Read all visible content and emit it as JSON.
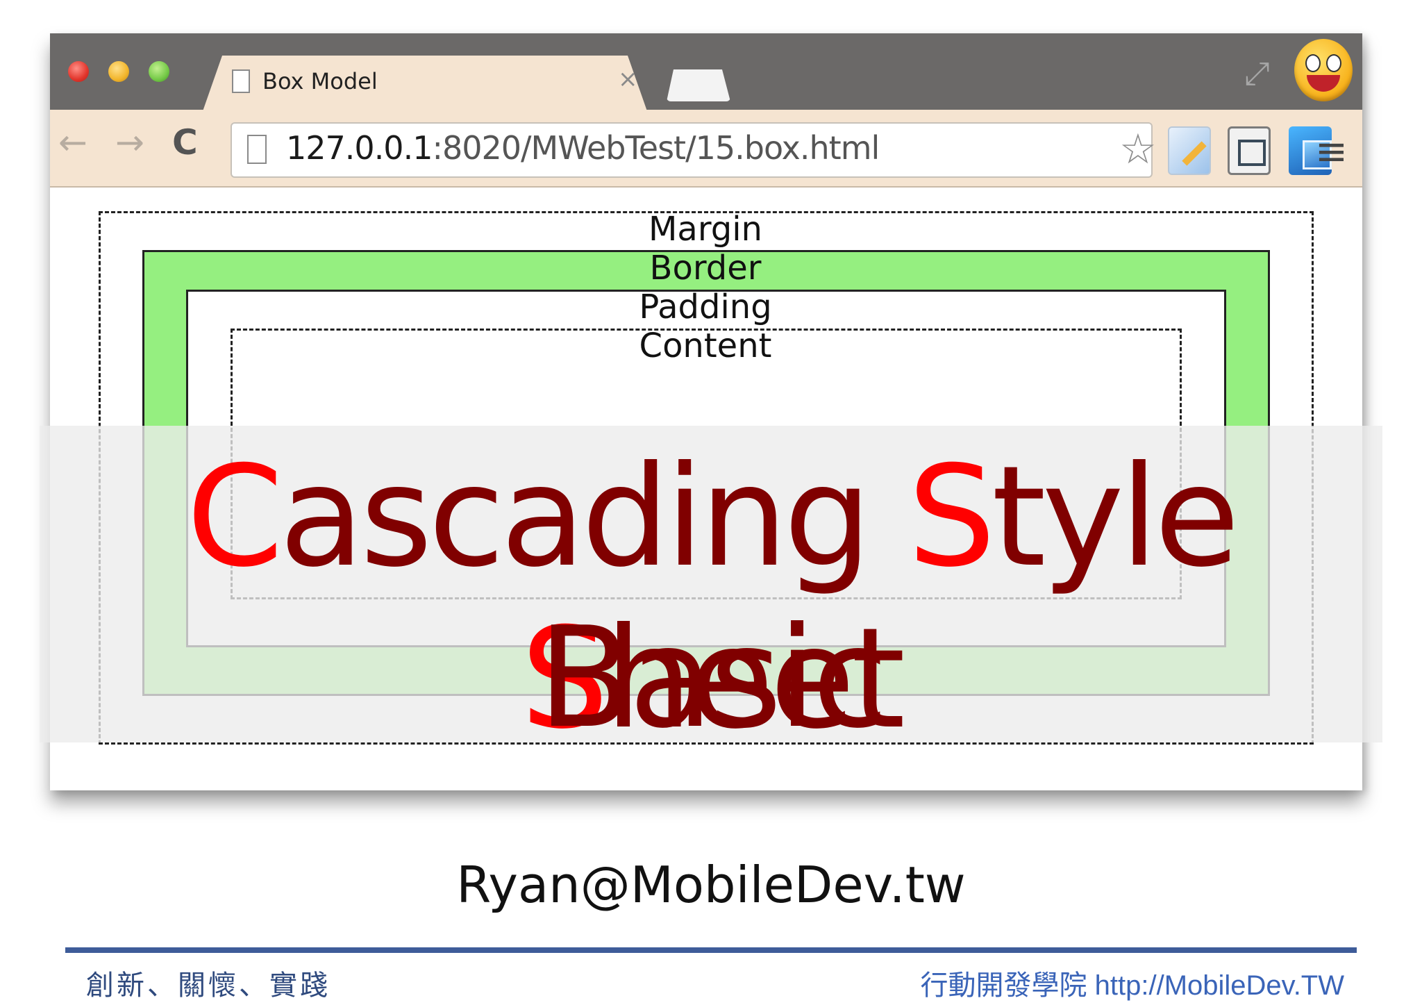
{
  "browser": {
    "tab_title": "Box Model",
    "tab_close": "×",
    "url_host": "127.0.0.1",
    "url_path": ":8020/MWebTest/15.box.html",
    "icons": {
      "back": "←",
      "forward": "→",
      "reload": "C",
      "bookmark": "☆",
      "menu": "≡",
      "fullscreen": "⤢"
    }
  },
  "diagram": {
    "margin_label": "Margin",
    "border_label": "Border",
    "padding_label": "Padding",
    "content_label": "Content"
  },
  "title": {
    "line1": {
      "c": "C",
      "ascading": "ascading ",
      "s1": "S",
      "tyle": "tyle ",
      "s2": "S",
      "heet": "heet"
    },
    "line2": "Basic"
  },
  "footer": {
    "email": "Ryan@MobileDev.tw",
    "motto": "創新、關懷、實踐",
    "academy": "行動開發學院 http://MobileDev.TW"
  },
  "colors": {
    "title_dark_red": "#800000",
    "title_red": "#ff0000",
    "border_green": "#95ef80",
    "footer_rule": "#3e5c99"
  }
}
